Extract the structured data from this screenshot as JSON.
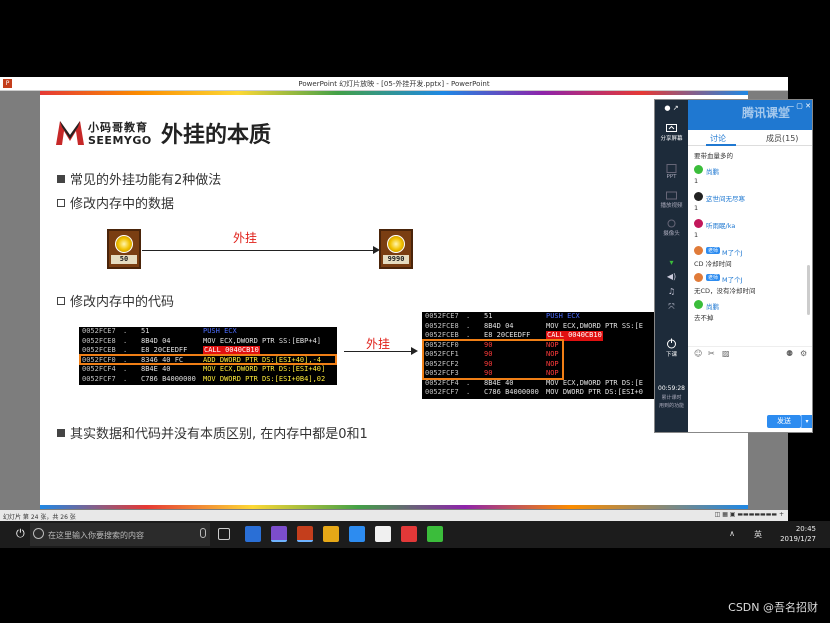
{
  "window": {
    "title": "PowerPoint 幻灯片放映 - [05-外挂开发.pptx] - PowerPoint",
    "app_icon": "P"
  },
  "slide": {
    "logo_cn": "小码哥教育",
    "logo_en": "SEEMYGO",
    "title": "外挂的本质",
    "bullet1": "常见的外挂功能有2种做法",
    "bullet2": "修改内存中的数据",
    "coin_before": "50",
    "coin_after": "9990",
    "arrow1_label": "外挂",
    "bullet3": "修改内存中的代码",
    "arrow2_label": "外挂",
    "bullet4": "其实数据和代码并没有本质区别, 在内存中都是0和1",
    "asm_left": [
      {
        "addr": "0052FCE7",
        "sep": ".",
        "bytes": "51",
        "instr": "PUSH ECX",
        "style": "blue"
      },
      {
        "addr": "0052FCE8",
        "sep": ".",
        "bytes": "8B4D 04",
        "instr": "MOV ECX,DWORD PTR SS:[EBP+4]",
        "style": "normal"
      },
      {
        "addr": "0052FCEB",
        "sep": ".",
        "bytes": "E8 20CEEDFF",
        "instr": "CALL 0040CB10",
        "style": "call"
      },
      {
        "addr": "0052FCF0",
        "sep": ".",
        "bytes": "8346 40 FC",
        "instr": "ADD DWORD PTR DS:[ESI+40],-4",
        "style": "yellow"
      },
      {
        "addr": "0052FCF4",
        "sep": ".",
        "bytes": "8B4E 40",
        "instr": "MOV ECX,DWORD PTR DS:[ESI+40]",
        "style": "yellow"
      },
      {
        "addr": "0052FCF7",
        "sep": ".",
        "bytes": "C786 B4000000",
        "instr": "MOV DWORD PTR DS:[ESI+0B4],02",
        "style": "yellow"
      }
    ],
    "asm_right": [
      {
        "addr": "0052FCE7",
        "sep": ".",
        "bytes": "51",
        "instr": "PUSH ECX",
        "style": "blue"
      },
      {
        "addr": "0052FCE8",
        "sep": ".",
        "bytes": "8B4D 04",
        "instr": "MOV ECX,DWORD PTR SS:[E",
        "style": "normal"
      },
      {
        "addr": "0052FCEB",
        "sep": ".",
        "bytes": "E8 20CEEDFF",
        "instr": "CALL 0040CB10",
        "style": "call"
      },
      {
        "addr": "0052FCF0",
        "sep": "",
        "bytes": "90",
        "instr": "NOP",
        "style": "nop"
      },
      {
        "addr": "0052FCF1",
        "sep": "",
        "bytes": "90",
        "instr": "NOP",
        "style": "nop"
      },
      {
        "addr": "0052FCF2",
        "sep": "",
        "bytes": "90",
        "instr": "NOP",
        "style": "nop"
      },
      {
        "addr": "0052FCF3",
        "sep": "",
        "bytes": "90",
        "instr": "NOP",
        "style": "nop"
      },
      {
        "addr": "0052FCF4",
        "sep": ".",
        "bytes": "8B4E 40",
        "instr": "MOV ECX,DWORD PTR DS:[E",
        "style": "normal"
      },
      {
        "addr": "0052FCF7",
        "sep": ".",
        "bytes": "C786 B4000000",
        "instr": "MOV DWORD PTR DS:[ESI+0",
        "style": "normal"
      }
    ]
  },
  "status_bar": {
    "slide_info": "幻灯片 第 24 张，共 26 张"
  },
  "taskbar": {
    "search_placeholder": "在这里输入你要搜索的内容",
    "lang": "英",
    "time": "20:45",
    "date": "2019/1/27"
  },
  "tencent": {
    "brand": "腾讯课堂",
    "tab_discuss": "讨论",
    "tab_members": "成员(15)",
    "side_share": "分享屏幕",
    "side_ppt": "PPT",
    "side_play": "播放视频",
    "side_mic": "摄像头",
    "side_end": "下课",
    "timer": "00:59:28",
    "timer_label": "累计课时",
    "side_more": "用到的功能",
    "messages": [
      {
        "type": "text",
        "text": "要带血量多的"
      },
      {
        "type": "user",
        "name": "尚鹏",
        "color": "#3bbd3b"
      },
      {
        "type": "text",
        "text": "1"
      },
      {
        "type": "user",
        "name": "这世间无尽寒",
        "color": "#222"
      },
      {
        "type": "text",
        "text": "1"
      },
      {
        "type": "user",
        "name": "听雨眠/ka",
        "color": "#c2185b"
      },
      {
        "type": "text",
        "text": "1"
      },
      {
        "type": "teacher",
        "badge": "老师",
        "name": "M了个J",
        "color": "#e07b39"
      },
      {
        "type": "text",
        "text": "CD 冷却时间"
      },
      {
        "type": "teacher",
        "badge": "老师",
        "name": "M了个J",
        "color": "#e07b39"
      },
      {
        "type": "text",
        "text": "无CD，没有冷却时间"
      },
      {
        "type": "user",
        "name": "尚鹏",
        "color": "#3bbd3b"
      },
      {
        "type": "text",
        "text": "去不掉"
      }
    ],
    "send_label": "发送",
    "send_arrow": "▾"
  },
  "watermark": "CSDN @吾名招财",
  "colors": {
    "accent_blue": "#1f78d1",
    "highlight_orange": "#f07f16",
    "arrow_label_red": "#e0211a"
  }
}
